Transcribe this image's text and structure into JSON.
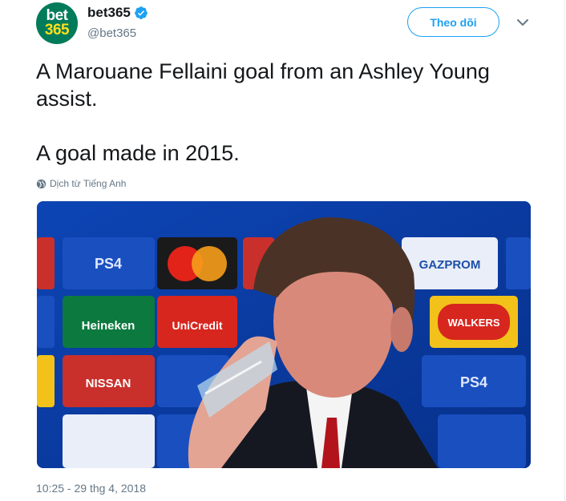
{
  "account": {
    "display_name": "bet365",
    "handle": "@bet365",
    "avatar_line1": "bet",
    "avatar_line2": "365",
    "verified": true
  },
  "header": {
    "follow_label": "Theo dõi",
    "menu_icon": "chevron-down-icon"
  },
  "tweet": {
    "text": "A Marouane Fellaini goal from an Ashley Young assist.\n\nA goal made in 2015.",
    "translate_label": "Dịch từ Tiếng Anh",
    "translate_icon": "globe-icon",
    "timestamp": "10:25 - 29 thg 4, 2018"
  },
  "media": {
    "brand_tiles": [
      "PS4",
      "mastercard",
      "GAZPROM",
      "Heineken",
      "UniCredit",
      "WALKERS",
      "NISSAN",
      "PS4"
    ]
  },
  "colors": {
    "accent": "#1da1f2",
    "avatar_bg": "#027b5b",
    "avatar_number": "#ffdf1b",
    "secondary_text": "#657786",
    "backdrop": "#0c3fa5"
  }
}
